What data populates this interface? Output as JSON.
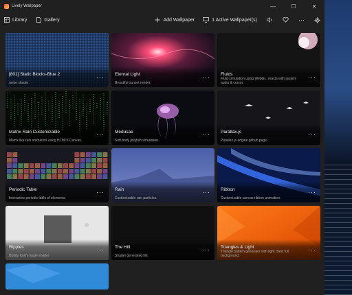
{
  "window": {
    "title": "Lively Wallpaper",
    "controls": [
      "—",
      "☐",
      "✕"
    ]
  },
  "toolbar": {
    "library_label": "Library",
    "gallery_label": "Gallery",
    "add_wallpaper_label": "Add Wallpaper",
    "active_wallpapers_label": "1 Active Wallpaper(s)",
    "more_label": "···"
  },
  "wallpapers": [
    {
      "title": "[801] Static Blocks-Blue 2",
      "desc": "noise shader",
      "theme": "blue-static",
      "selected": true
    },
    {
      "title": "Eternal Light",
      "desc": "Beautiful sunset render.",
      "theme": "eternal-light"
    },
    {
      "title": "Fluids",
      "desc": "Fluid simulation using WebGL, reacts with system audio & cursor.",
      "theme": "fluids"
    },
    {
      "title": "Matrix Rain Customizable",
      "desc": "Matrix like rain animation using HTML5 Canvas.",
      "theme": "matrix"
    },
    {
      "title": "Medusae",
      "desc": "Soft body jellyfish simulation.",
      "theme": "medusae"
    },
    {
      "title": "Parallax.js",
      "desc": "Parallax.js engine github page.",
      "theme": "parallax"
    },
    {
      "title": "Periodic Table",
      "desc": "Interactive periodic table of elements.",
      "theme": "periodic"
    },
    {
      "title": "Rain",
      "desc": "Customizable rain particles.",
      "theme": "rain"
    },
    {
      "title": "Ribbon",
      "desc": "Customizable canvas ribbon animation.",
      "theme": "ribbon"
    },
    {
      "title": "Ripples",
      "desc": "Buddy Kurt's ripple shader",
      "theme": "ripples"
    },
    {
      "title": "The Hill",
      "desc": "Shader generated hill.",
      "theme": "hill"
    },
    {
      "title": "Triangles & Light",
      "desc": "Triangle pattern generator with light. Best full background.",
      "theme": "triangles"
    },
    {
      "title": "",
      "desc": "",
      "theme": "blue-partial"
    }
  ],
  "card_more_label": "···",
  "colors": {
    "window_bg": "#202020",
    "selection": "#9cc6ff",
    "accent_orange": "#ff6a1a"
  }
}
